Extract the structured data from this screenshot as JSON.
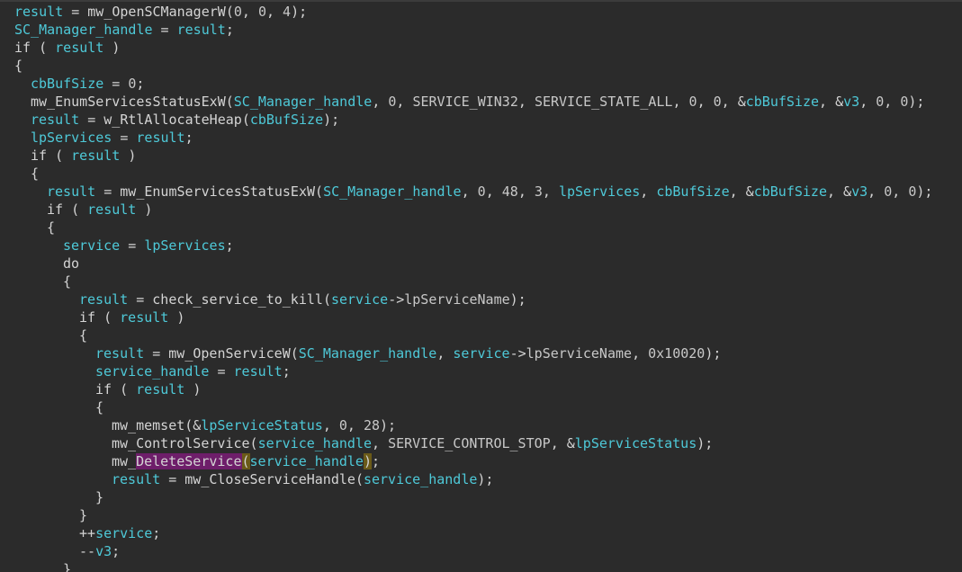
{
  "theme": {
    "background": "#2b2b2b",
    "text_default": "#d4d4d4",
    "variable_color": "#4ec9d8",
    "constant_color": "#c8c8c8",
    "highlight_word_bg": "#6e1e6a",
    "highlight_paren_bg": "#6a5a18"
  },
  "code": {
    "lines": [
      {
        "indent": 0,
        "tokens": [
          {
            "t": "result",
            "c": "var"
          },
          {
            "t": " = ",
            "c": "punc"
          },
          {
            "t": "mw_OpenSCManagerW",
            "c": "func"
          },
          {
            "t": "(",
            "c": "punc"
          },
          {
            "t": "0",
            "c": "num"
          },
          {
            "t": ", ",
            "c": "punc"
          },
          {
            "t": "0",
            "c": "num"
          },
          {
            "t": ", ",
            "c": "punc"
          },
          {
            "t": "4",
            "c": "num"
          },
          {
            "t": ");",
            "c": "punc"
          }
        ]
      },
      {
        "indent": 0,
        "tokens": [
          {
            "t": "SC_Manager_handle",
            "c": "var"
          },
          {
            "t": " = ",
            "c": "punc"
          },
          {
            "t": "result",
            "c": "var"
          },
          {
            "t": ";",
            "c": "punc"
          }
        ]
      },
      {
        "indent": 0,
        "tokens": [
          {
            "t": "if",
            "c": "kw"
          },
          {
            "t": " ( ",
            "c": "punc"
          },
          {
            "t": "result",
            "c": "var"
          },
          {
            "t": " )",
            "c": "punc"
          }
        ]
      },
      {
        "indent": 0,
        "tokens": [
          {
            "t": "{",
            "c": "punc"
          }
        ]
      },
      {
        "indent": 1,
        "tokens": [
          {
            "t": "cbBufSize",
            "c": "var"
          },
          {
            "t": " = ",
            "c": "punc"
          },
          {
            "t": "0",
            "c": "num"
          },
          {
            "t": ";",
            "c": "punc"
          }
        ]
      },
      {
        "indent": 1,
        "tokens": [
          {
            "t": "mw_EnumServicesStatusExW",
            "c": "func"
          },
          {
            "t": "(",
            "c": "punc"
          },
          {
            "t": "SC_Manager_handle",
            "c": "var"
          },
          {
            "t": ", ",
            "c": "punc"
          },
          {
            "t": "0",
            "c": "num"
          },
          {
            "t": ", ",
            "c": "punc"
          },
          {
            "t": "SERVICE_WIN32",
            "c": "const"
          },
          {
            "t": ", ",
            "c": "punc"
          },
          {
            "t": "SERVICE_STATE_ALL",
            "c": "const"
          },
          {
            "t": ", ",
            "c": "punc"
          },
          {
            "t": "0",
            "c": "num"
          },
          {
            "t": ", ",
            "c": "punc"
          },
          {
            "t": "0",
            "c": "num"
          },
          {
            "t": ", &",
            "c": "punc"
          },
          {
            "t": "cbBufSize",
            "c": "var"
          },
          {
            "t": ", &",
            "c": "punc"
          },
          {
            "t": "v3",
            "c": "var"
          },
          {
            "t": ", ",
            "c": "punc"
          },
          {
            "t": "0",
            "c": "num"
          },
          {
            "t": ", ",
            "c": "punc"
          },
          {
            "t": "0",
            "c": "num"
          },
          {
            "t": ");",
            "c": "punc"
          }
        ]
      },
      {
        "indent": 1,
        "tokens": [
          {
            "t": "result",
            "c": "var"
          },
          {
            "t": " = ",
            "c": "punc"
          },
          {
            "t": "w_RtlAllocateHeap",
            "c": "func"
          },
          {
            "t": "(",
            "c": "punc"
          },
          {
            "t": "cbBufSize",
            "c": "var"
          },
          {
            "t": ");",
            "c": "punc"
          }
        ]
      },
      {
        "indent": 1,
        "tokens": [
          {
            "t": "lpServices",
            "c": "var"
          },
          {
            "t": " = ",
            "c": "punc"
          },
          {
            "t": "result",
            "c": "var"
          },
          {
            "t": ";",
            "c": "punc"
          }
        ]
      },
      {
        "indent": 1,
        "tokens": [
          {
            "t": "if",
            "c": "kw"
          },
          {
            "t": " ( ",
            "c": "punc"
          },
          {
            "t": "result",
            "c": "var"
          },
          {
            "t": " )",
            "c": "punc"
          }
        ]
      },
      {
        "indent": 1,
        "tokens": [
          {
            "t": "{",
            "c": "punc"
          }
        ]
      },
      {
        "indent": 2,
        "tokens": [
          {
            "t": "result",
            "c": "var"
          },
          {
            "t": " = ",
            "c": "punc"
          },
          {
            "t": "mw_EnumServicesStatusExW",
            "c": "func"
          },
          {
            "t": "(",
            "c": "punc"
          },
          {
            "t": "SC_Manager_handle",
            "c": "var"
          },
          {
            "t": ", ",
            "c": "punc"
          },
          {
            "t": "0",
            "c": "num"
          },
          {
            "t": ", ",
            "c": "punc"
          },
          {
            "t": "48",
            "c": "num"
          },
          {
            "t": ", ",
            "c": "punc"
          },
          {
            "t": "3",
            "c": "num"
          },
          {
            "t": ", ",
            "c": "punc"
          },
          {
            "t": "lpServices",
            "c": "var"
          },
          {
            "t": ", ",
            "c": "punc"
          },
          {
            "t": "cbBufSize",
            "c": "var"
          },
          {
            "t": ", &",
            "c": "punc"
          },
          {
            "t": "cbBufSize",
            "c": "var"
          },
          {
            "t": ", &",
            "c": "punc"
          },
          {
            "t": "v3",
            "c": "var"
          },
          {
            "t": ", ",
            "c": "punc"
          },
          {
            "t": "0",
            "c": "num"
          },
          {
            "t": ", ",
            "c": "punc"
          },
          {
            "t": "0",
            "c": "num"
          },
          {
            "t": ");",
            "c": "punc"
          }
        ]
      },
      {
        "indent": 2,
        "tokens": [
          {
            "t": "if",
            "c": "kw"
          },
          {
            "t": " ( ",
            "c": "punc"
          },
          {
            "t": "result",
            "c": "var"
          },
          {
            "t": " )",
            "c": "punc"
          }
        ]
      },
      {
        "indent": 2,
        "tokens": [
          {
            "t": "{",
            "c": "punc"
          }
        ]
      },
      {
        "indent": 3,
        "tokens": [
          {
            "t": "service",
            "c": "var"
          },
          {
            "t": " = ",
            "c": "punc"
          },
          {
            "t": "lpServices",
            "c": "var"
          },
          {
            "t": ";",
            "c": "punc"
          }
        ]
      },
      {
        "indent": 3,
        "tokens": [
          {
            "t": "do",
            "c": "kw"
          }
        ]
      },
      {
        "indent": 3,
        "tokens": [
          {
            "t": "{",
            "c": "punc"
          }
        ]
      },
      {
        "indent": 4,
        "tokens": [
          {
            "t": "result",
            "c": "var"
          },
          {
            "t": " = ",
            "c": "punc"
          },
          {
            "t": "check_service_to_kill",
            "c": "func"
          },
          {
            "t": "(",
            "c": "punc"
          },
          {
            "t": "service",
            "c": "var"
          },
          {
            "t": "->",
            "c": "punc"
          },
          {
            "t": "lpServiceName",
            "c": "const"
          },
          {
            "t": ");",
            "c": "punc"
          }
        ]
      },
      {
        "indent": 4,
        "tokens": [
          {
            "t": "if",
            "c": "kw"
          },
          {
            "t": " ( ",
            "c": "punc"
          },
          {
            "t": "result",
            "c": "var"
          },
          {
            "t": " )",
            "c": "punc"
          }
        ]
      },
      {
        "indent": 4,
        "tokens": [
          {
            "t": "{",
            "c": "punc"
          }
        ]
      },
      {
        "indent": 5,
        "tokens": [
          {
            "t": "result",
            "c": "var"
          },
          {
            "t": " = ",
            "c": "punc"
          },
          {
            "t": "mw_OpenServiceW",
            "c": "func"
          },
          {
            "t": "(",
            "c": "punc"
          },
          {
            "t": "SC_Manager_handle",
            "c": "var"
          },
          {
            "t": ", ",
            "c": "punc"
          },
          {
            "t": "service",
            "c": "var"
          },
          {
            "t": "->",
            "c": "punc"
          },
          {
            "t": "lpServiceName",
            "c": "const"
          },
          {
            "t": ", ",
            "c": "punc"
          },
          {
            "t": "0x10020",
            "c": "num"
          },
          {
            "t": ");",
            "c": "punc"
          }
        ]
      },
      {
        "indent": 5,
        "tokens": [
          {
            "t": "service_handle",
            "c": "var"
          },
          {
            "t": " = ",
            "c": "punc"
          },
          {
            "t": "result",
            "c": "var"
          },
          {
            "t": ";",
            "c": "punc"
          }
        ]
      },
      {
        "indent": 5,
        "tokens": [
          {
            "t": "if",
            "c": "kw"
          },
          {
            "t": " ( ",
            "c": "punc"
          },
          {
            "t": "result",
            "c": "var"
          },
          {
            "t": " )",
            "c": "punc"
          }
        ]
      },
      {
        "indent": 5,
        "tokens": [
          {
            "t": "{",
            "c": "punc"
          }
        ]
      },
      {
        "indent": 6,
        "tokens": [
          {
            "t": "mw_memset",
            "c": "func"
          },
          {
            "t": "(&",
            "c": "punc"
          },
          {
            "t": "lpServiceStatus",
            "c": "var"
          },
          {
            "t": ", ",
            "c": "punc"
          },
          {
            "t": "0",
            "c": "num"
          },
          {
            "t": ", ",
            "c": "punc"
          },
          {
            "t": "28",
            "c": "num"
          },
          {
            "t": ");",
            "c": "punc"
          }
        ]
      },
      {
        "indent": 6,
        "tokens": [
          {
            "t": "mw_ControlService",
            "c": "func"
          },
          {
            "t": "(",
            "c": "punc"
          },
          {
            "t": "service_handle",
            "c": "var"
          },
          {
            "t": ", ",
            "c": "punc"
          },
          {
            "t": "SERVICE_CONTROL_STOP",
            "c": "const"
          },
          {
            "t": ", &",
            "c": "punc"
          },
          {
            "t": "lpServiceStatus",
            "c": "var"
          },
          {
            "t": ");",
            "c": "punc"
          }
        ]
      },
      {
        "indent": 6,
        "tokens": [
          {
            "t": "mw_",
            "c": "func"
          },
          {
            "t": "DeleteService",
            "c": "func",
            "hl": "word"
          },
          {
            "t": "(",
            "c": "punc",
            "hl": "paren"
          },
          {
            "t": "service_handle",
            "c": "var"
          },
          {
            "t": ")",
            "c": "punc",
            "hl": "paren"
          },
          {
            "t": ";",
            "c": "punc"
          }
        ]
      },
      {
        "indent": 6,
        "tokens": [
          {
            "t": "result",
            "c": "var"
          },
          {
            "t": " = ",
            "c": "punc"
          },
          {
            "t": "mw_CloseServiceHandle",
            "c": "func"
          },
          {
            "t": "(",
            "c": "punc"
          },
          {
            "t": "service_handle",
            "c": "var"
          },
          {
            "t": ");",
            "c": "punc"
          }
        ]
      },
      {
        "indent": 5,
        "tokens": [
          {
            "t": "}",
            "c": "punc"
          }
        ]
      },
      {
        "indent": 4,
        "tokens": [
          {
            "t": "}",
            "c": "punc"
          }
        ]
      },
      {
        "indent": 4,
        "tokens": [
          {
            "t": "++",
            "c": "punc"
          },
          {
            "t": "service",
            "c": "var"
          },
          {
            "t": ";",
            "c": "punc"
          }
        ]
      },
      {
        "indent": 4,
        "tokens": [
          {
            "t": "--",
            "c": "punc"
          },
          {
            "t": "v3",
            "c": "var"
          },
          {
            "t": ";",
            "c": "punc"
          }
        ]
      },
      {
        "indent": 3,
        "tokens": [
          {
            "t": "}",
            "c": "punc"
          }
        ]
      }
    ]
  }
}
